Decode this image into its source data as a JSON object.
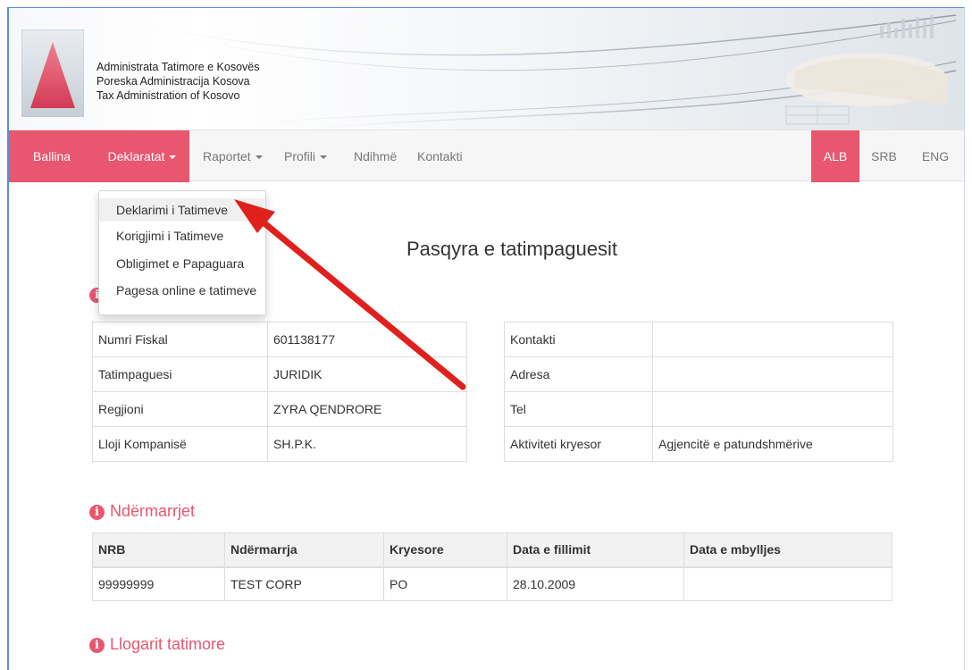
{
  "header": {
    "org_names": [
      "Administrata Tatimore e Kosovës",
      "Poreska Administracija Kosova",
      "Tax Administration of Kosovo"
    ]
  },
  "nav": {
    "home": "Ballina",
    "declarations": "Deklaratat",
    "reports": "Raportet",
    "profile": "Profili",
    "help": "Ndihmë",
    "contact": "Kontakti",
    "lang_alb": "ALB",
    "lang_srb": "SRB",
    "lang_eng": "ENG"
  },
  "dropdown": {
    "items": [
      "Deklarimi i Tatimeve",
      "Korigjimi i Tatimeve",
      "Obligimet e Papaguara",
      "Pagesa online e tatimeve"
    ]
  },
  "page_title": "Pasqyra e tatimpaguesit",
  "taxpayer_left": [
    {
      "label": "Numri Fiskal",
      "value": "601138177"
    },
    {
      "label": "Tatimpaguesi",
      "value": "JURIDIK"
    },
    {
      "label": "Regjioni",
      "value": "ZYRA QENDRORE"
    },
    {
      "label": "Lloji Kompanisë",
      "value": "SH.P.K."
    }
  ],
  "taxpayer_right": [
    {
      "label": "Kontakti",
      "value": ""
    },
    {
      "label": "Adresa",
      "value": ""
    },
    {
      "label": "Tel",
      "value": ""
    },
    {
      "label": "Aktiviteti kryesor",
      "value": "Agjencitë e patundshmërive"
    }
  ],
  "enterprises": {
    "title": "Ndërmarrjet",
    "columns": [
      "NRB",
      "Ndërmarrja",
      "Kryesore",
      "Data e fillimit",
      "Data e mbylljes"
    ],
    "rows": [
      [
        "99999999",
        "TEST CORP",
        "PO",
        "28.10.2009",
        ""
      ]
    ]
  },
  "tax_accounts": {
    "title": "Llogarit tatimore"
  },
  "colors": {
    "accent": "#e8566f",
    "arrow": "#e0201c"
  }
}
